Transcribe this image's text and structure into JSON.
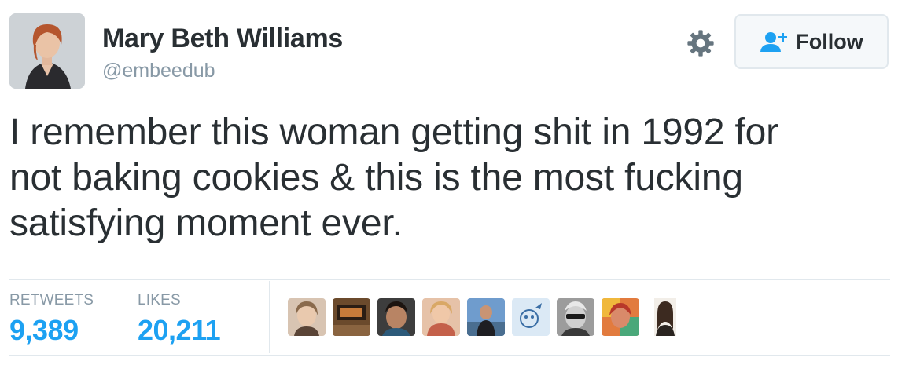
{
  "author": {
    "name": "Mary Beth Williams",
    "handle": "@embeedub"
  },
  "follow_button": {
    "label": "Follow",
    "icon": "person-plus-icon"
  },
  "settings_icon": "gear-icon",
  "tweet": {
    "lines": [
      "I remember this woman getting shit in 1992 for",
      "not baking cookies & this is the most fucking",
      "satisfying moment ever."
    ]
  },
  "stats": {
    "retweets_label": "RETWEETS",
    "retweets_value": "9,389",
    "likes_label": "LIKES",
    "likes_value": "20,211"
  },
  "liker_avatars": [
    {
      "name": "liker-avatar-1",
      "color": "#b89a86"
    },
    {
      "name": "liker-avatar-2",
      "color": "#7a5a38"
    },
    {
      "name": "liker-avatar-3",
      "color": "#5b4a40"
    },
    {
      "name": "liker-avatar-4",
      "color": "#c48674"
    },
    {
      "name": "liker-avatar-5",
      "color": "#6f8aa6"
    },
    {
      "name": "liker-avatar-6",
      "color": "#9fc3e0"
    },
    {
      "name": "liker-avatar-7",
      "color": "#8a8a8a"
    },
    {
      "name": "liker-avatar-8",
      "color": "#d9704a"
    },
    {
      "name": "liker-avatar-9",
      "color": "#6e5a4c"
    }
  ],
  "colors": {
    "link_blue": "#1da1f2",
    "text": "#292f33",
    "muted": "#8899a6",
    "border": "#e1e8ed"
  }
}
